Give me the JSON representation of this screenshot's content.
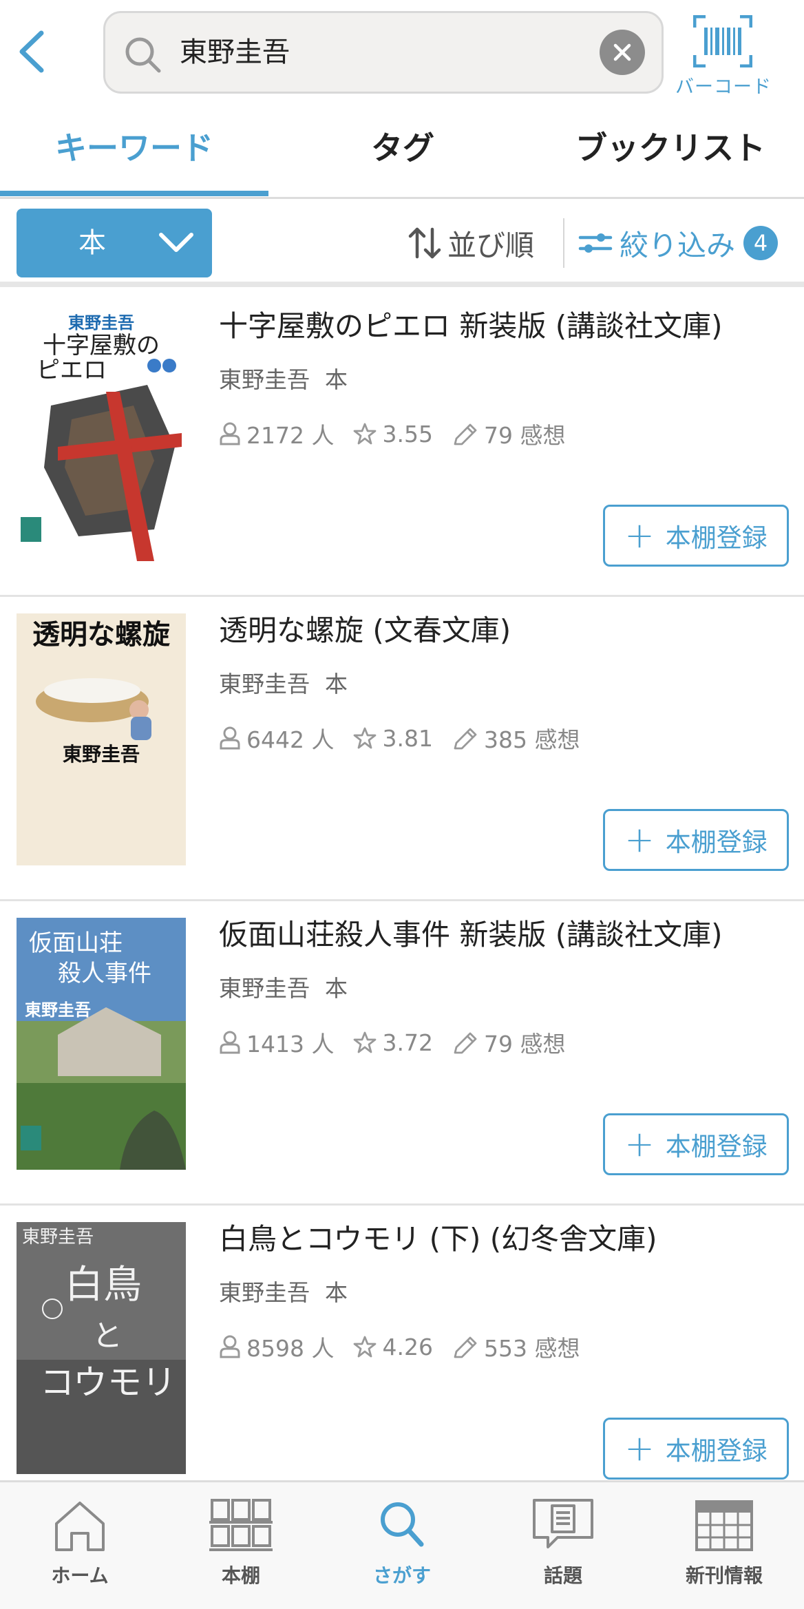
{
  "search": {
    "query": "東野圭吾",
    "barcode_label": "バーコード"
  },
  "tabs": [
    {
      "label": "キーワード",
      "active": true
    },
    {
      "label": "タグ",
      "active": false
    },
    {
      "label": "ブックリスト",
      "active": false
    }
  ],
  "filter": {
    "type_label": "本",
    "sort_label": "並び順",
    "filter_label": "絞り込み",
    "filter_count": "4"
  },
  "books": [
    {
      "title": "十字屋敷のピエロ 新装版 (講談社文庫)",
      "author": "東野圭吾",
      "kind": "本",
      "readers": "2172 人",
      "rating": "3.55",
      "reviews": "79 感想",
      "add_label": "本棚登録",
      "cover_text": "十字屋敷のピエロ",
      "cover_author": "東野圭吾"
    },
    {
      "title": "透明な螺旋 (文春文庫)",
      "author": "東野圭吾",
      "kind": "本",
      "readers": "6442 人",
      "rating": "3.81",
      "reviews": "385 感想",
      "add_label": "本棚登録",
      "cover_text": "透明な螺旋",
      "cover_author": "東野圭吾"
    },
    {
      "title": "仮面山荘殺人事件 新装版 (講談社文庫)",
      "author": "東野圭吾",
      "kind": "本",
      "readers": "1413 人",
      "rating": "3.72",
      "reviews": "79 感想",
      "add_label": "本棚登録",
      "cover_text": "仮面山荘殺人事件",
      "cover_author": "東野圭吾"
    },
    {
      "title": "白鳥とコウモリ (下) (幻冬舎文庫)",
      "author": "東野圭吾",
      "kind": "本",
      "readers": "8598 人",
      "rating": "4.26",
      "reviews": "553 感想",
      "add_label": "本棚登録",
      "cover_text": "白鳥とコウモリ",
      "cover_author": "東野圭吾"
    }
  ],
  "nav": [
    {
      "label": "ホーム",
      "icon": "home-icon",
      "active": false
    },
    {
      "label": "本棚",
      "icon": "bookshelf-icon",
      "active": false
    },
    {
      "label": "さがす",
      "icon": "search-icon",
      "active": true
    },
    {
      "label": "話題",
      "icon": "topic-icon",
      "active": false
    },
    {
      "label": "新刊情報",
      "icon": "calendar-icon",
      "active": false
    }
  ],
  "colors": {
    "accent": "#4a9fd0",
    "text": "#222222",
    "muted": "#888888"
  }
}
